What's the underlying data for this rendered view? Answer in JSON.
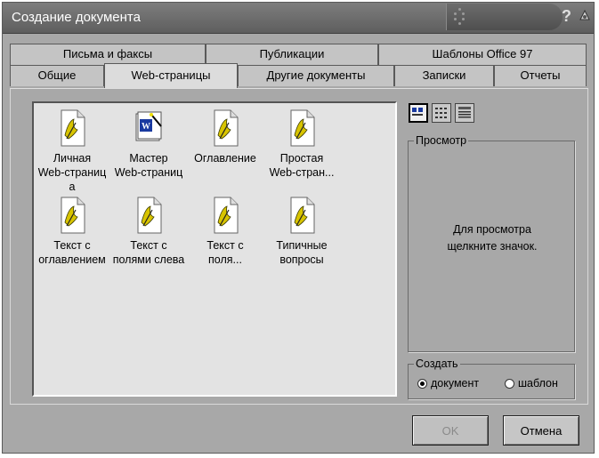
{
  "window": {
    "title": "Создание документа",
    "help_icon": "?"
  },
  "tabs": {
    "row1": [
      {
        "label": "Письма и факсы"
      },
      {
        "label": "Публикации"
      },
      {
        "label": "Шаблоны Office 97"
      }
    ],
    "row2": [
      {
        "label": "Общие"
      },
      {
        "label": "Web-страницы"
      },
      {
        "label": "Другие документы"
      },
      {
        "label": "Записки"
      },
      {
        "label": "Отчеты"
      }
    ],
    "active": "Web-страницы"
  },
  "templates": [
    {
      "line1": "Личная",
      "line2": "Web-страниц",
      "line3": "а",
      "icon": "web-page-template-icon"
    },
    {
      "line1": "Мастер",
      "line2": "Web-страниц",
      "line3": "",
      "icon": "wizard-icon"
    },
    {
      "line1": "Оглавление",
      "line2": "",
      "line3": "",
      "icon": "web-page-template-icon"
    },
    {
      "line1": "Простая",
      "line2": "Web-стран...",
      "line3": "",
      "icon": "web-page-template-icon"
    },
    {
      "line1": "Текст с",
      "line2": "оглавлением",
      "line3": "",
      "icon": "web-page-template-icon"
    },
    {
      "line1": "Текст с",
      "line2": "полями слева",
      "line3": "",
      "icon": "web-page-template-icon"
    },
    {
      "line1": "Текст с",
      "line2": "поля...",
      "line3": "",
      "icon": "web-page-template-icon"
    },
    {
      "line1": "Типичные",
      "line2": "вопросы",
      "line3": "",
      "icon": "web-page-template-icon"
    }
  ],
  "preview": {
    "label": "Просмотр",
    "line1": "Для просмотра",
    "line2": "щелкните значок."
  },
  "create": {
    "label": "Создать",
    "option_document": "документ",
    "option_template": "шаблон",
    "selected": "документ"
  },
  "buttons": {
    "ok": "OK",
    "cancel": "Отмена"
  },
  "colors": {
    "dialog_bg": "#a8a8a8",
    "titlebar": "#6a6a6a",
    "icon_area": "#e3e3e3",
    "doc_icon_accent": "#d8c400"
  }
}
